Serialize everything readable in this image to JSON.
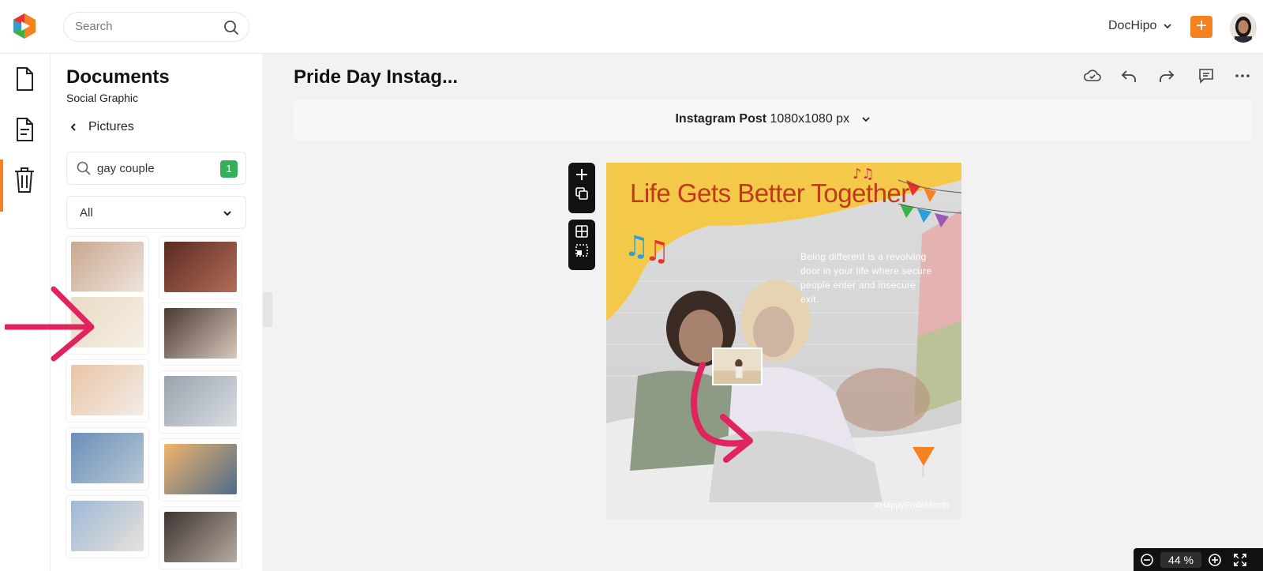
{
  "app": {
    "logo_icon": "dochipo-logo-icon",
    "brand_color": "#f58220"
  },
  "search": {
    "placeholder": "Search"
  },
  "account": {
    "name": "DocHipo",
    "plus_label": "+"
  },
  "rail": {
    "items": [
      "document-icon",
      "file-text-icon",
      "trash-icon"
    ]
  },
  "panel": {
    "title": "Documents",
    "subtitle": "Social Graphic",
    "back_label": "Pictures",
    "search_query": "gay couple",
    "result_badge": "1",
    "filter_value": "All",
    "thumbnails": [
      {
        "colors": [
          "#c9a790",
          "#efe4dc"
        ]
      },
      {
        "colors": [
          "#5a2a22",
          "#b36d58"
        ]
      },
      {
        "colors": [
          "#e9dcc6",
          "#f5eee2"
        ]
      },
      {
        "colors": [
          "#4b3a33",
          "#d7c8bb"
        ]
      },
      {
        "colors": [
          "#e8c5a6",
          "#f3ece6"
        ]
      },
      {
        "colors": [
          "#9aa3ad",
          "#d8dde2"
        ]
      },
      {
        "colors": [
          "#6b8fb7",
          "#b8c8d6"
        ]
      },
      {
        "colors": [
          "#f0b46a",
          "#4f6c8c"
        ]
      },
      {
        "colors": [
          "#9db8d6",
          "#e8e2dc"
        ]
      },
      {
        "colors": [
          "#3d3431",
          "#b7aaa0"
        ]
      }
    ]
  },
  "main": {
    "doc_title": "Pride Day Instag...",
    "size_type": "Instagram Post",
    "size_dims": "1080x1080 px",
    "toolbar_icons": [
      "cloud-saved-icon",
      "undo-icon",
      "redo-icon",
      "comment-icon",
      "more-icon"
    ]
  },
  "canvas": {
    "headline": "Life Gets Better Together",
    "quote": "Being different is a revolving door in your life where secure people enter and insecure exit.",
    "hashtag": "#HappyPrideMonth",
    "accent_yellow": "#f6c842",
    "headline_color": "#c0391b"
  },
  "zoom": {
    "value": "44",
    "unit": "%"
  },
  "annotation_color": "#e0245e"
}
